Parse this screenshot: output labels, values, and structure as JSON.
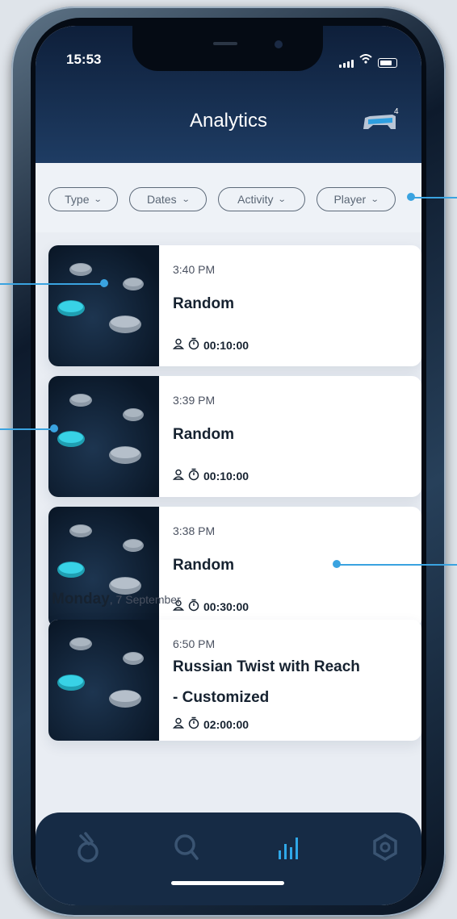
{
  "status_bar": {
    "time": "15:53"
  },
  "header": {
    "title": "Analytics",
    "controller_badge": "4"
  },
  "filters": [
    "Type",
    "Dates",
    "Activity",
    "Player"
  ],
  "sessions": [
    {
      "time": "3:40 PM",
      "title": "Random",
      "duration": "00:10:00"
    },
    {
      "time": "3:39 PM",
      "title": "Random",
      "duration": "00:10:00"
    },
    {
      "time": "3:38 PM",
      "title": "Random",
      "duration": "00:30:00"
    }
  ],
  "day_group": {
    "day": "Monday",
    "date": ", 7 September",
    "sessions": [
      {
        "time": "6:50 PM",
        "title_line1": "Russian Twist with Reach",
        "title_line2": "- Customized",
        "duration": "02:00:00"
      }
    ]
  },
  "tab_bar": {
    "items": [
      "hand-icon",
      "search-icon",
      "analytics-icon",
      "settings-icon"
    ],
    "active": "analytics-icon"
  },
  "colors": {
    "header": "#1e3c63",
    "accent": "#3aa3e0",
    "pod_active": "#38d2e6",
    "tab_bar": "#162b45"
  }
}
